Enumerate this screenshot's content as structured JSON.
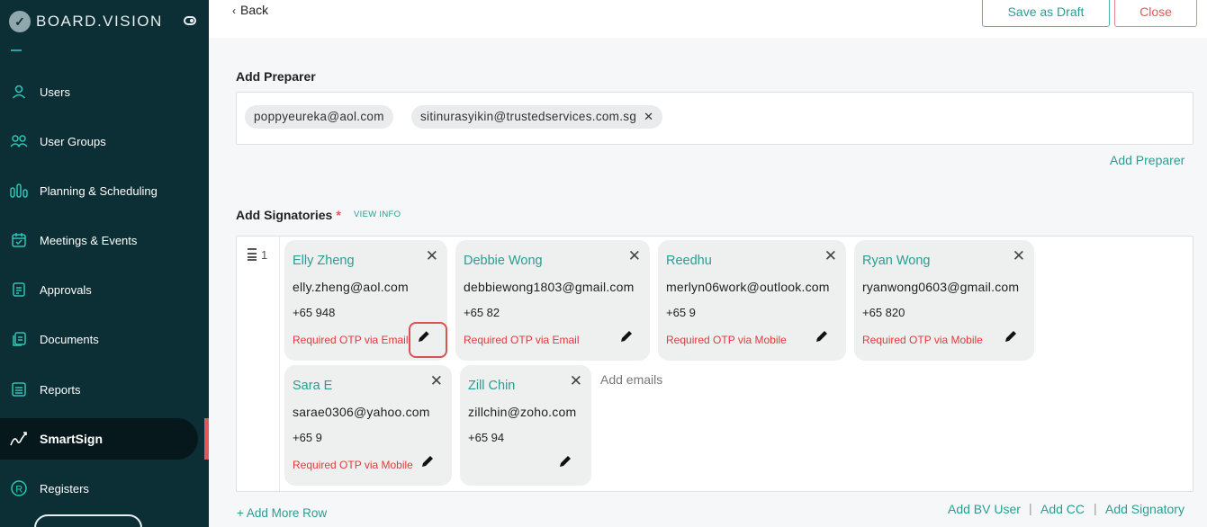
{
  "brand": {
    "name": "BOARD.VISION"
  },
  "sidebar": {
    "items": [
      {
        "label": "Users",
        "icon": "user-icon"
      },
      {
        "label": "User Groups",
        "icon": "user-groups-icon"
      },
      {
        "label": "Planning & Scheduling",
        "icon": "planning-icon"
      },
      {
        "label": "Meetings & Events",
        "icon": "calendar-icon"
      },
      {
        "label": "Approvals",
        "icon": "approvals-icon"
      },
      {
        "label": "Documents",
        "icon": "documents-icon"
      },
      {
        "label": "Reports",
        "icon": "reports-icon"
      },
      {
        "label": "SmartSign",
        "icon": "smartsign-icon",
        "active": true
      },
      {
        "label": "Registers",
        "icon": "registers-icon"
      }
    ]
  },
  "topbar": {
    "back": "Back",
    "save_draft": "Save as Draft",
    "close": "Close"
  },
  "preparer": {
    "label": "Add Preparer",
    "chips": [
      "poppyeureka@aol.com",
      "sitinurasyikin@trustedservices.com.sg"
    ],
    "add_link": "Add Preparer"
  },
  "signatories": {
    "label": "Add Signatories",
    "required_mark": "*",
    "view_info": "VIEW INFO",
    "row_number": "1",
    "cards": [
      {
        "name": "Elly Zheng",
        "email": "elly.zheng@aol.com",
        "phone": "+65 948",
        "otp": "Required OTP via Email"
      },
      {
        "name": "Debbie Wong",
        "email": "debbiewong1803@gmail.com",
        "phone": "+65 82",
        "otp": "Required OTP via Email"
      },
      {
        "name": "Reedhu",
        "email": "merlyn06work@outlook.com",
        "phone": "+65 9",
        "otp": "Required OTP via Mobile"
      },
      {
        "name": "Ryan Wong",
        "email": "ryanwong0603@gmail.com",
        "phone": "+65 820",
        "otp": "Required OTP via Mobile"
      },
      {
        "name": "Sara E",
        "email": "sarae0306@yahoo.com",
        "phone": "+65 9",
        "otp": "Required OTP via Mobile"
      },
      {
        "name": "Zill Chin",
        "email": "zillchin@zoho.com",
        "phone": "+65 94",
        "otp": ""
      }
    ],
    "add_emails_placeholder": "Add emails",
    "add_more_row": "+ Add More Row",
    "links": {
      "add_bv_user": "Add BV User",
      "add_cc": "Add CC",
      "add_signatory": "Add Signatory"
    }
  },
  "colors": {
    "sidebar_bg": "#0c2f36",
    "accent": "#2a9d93",
    "danger": "#e2575a"
  }
}
